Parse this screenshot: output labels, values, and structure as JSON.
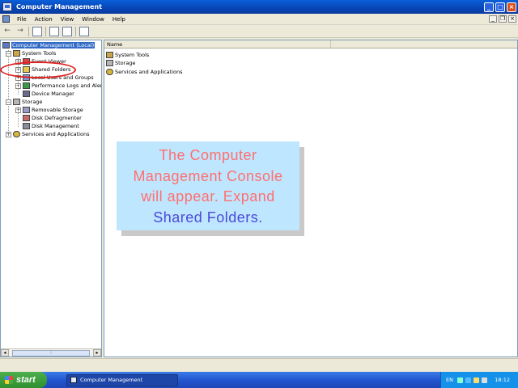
{
  "window": {
    "title": "Computer Management",
    "controls": {
      "minimize": "_",
      "maximize": "□",
      "close": "×"
    }
  },
  "menubar": {
    "items": [
      "File",
      "Action",
      "View",
      "Window",
      "Help"
    ],
    "mdi_controls": {
      "minimize": "_",
      "restore": "❐",
      "close": "×"
    }
  },
  "toolbar": {
    "back": "←",
    "forward": "→"
  },
  "tree": {
    "root": "Computer Management (Local)",
    "system_tools": "System Tools",
    "event_viewer": "Event Viewer",
    "shared_folders": "Shared Folders",
    "local_users": "Local Users and Groups",
    "performance": "Performance Logs and Alerts",
    "device_manager": "Device Manager",
    "storage": "Storage",
    "removable_storage": "Removable Storage",
    "disk_defragmenter": "Disk Defragmenter",
    "disk_management": "Disk Management",
    "services": "Services and Applications",
    "expand_symbol": "+",
    "collapse_symbol": "−"
  },
  "list": {
    "column_name": "Name",
    "items": [
      "System Tools",
      "Storage",
      "Services and Applications"
    ]
  },
  "callout": {
    "line1": "The Computer",
    "line2": "Management Console",
    "line3": "will appear. Expand",
    "line4": "Shared Folders."
  },
  "taskbar": {
    "start_label": "start",
    "task_label": "Computer Management",
    "language": "EN",
    "clock": "18:12"
  },
  "colors": {
    "callout_bg": "#bfe6ff",
    "callout_text": "#ff6f6f",
    "callout_highlight": "#4a4ad8",
    "highlight_ellipse": "#e02020",
    "selection": "#316ac5"
  }
}
